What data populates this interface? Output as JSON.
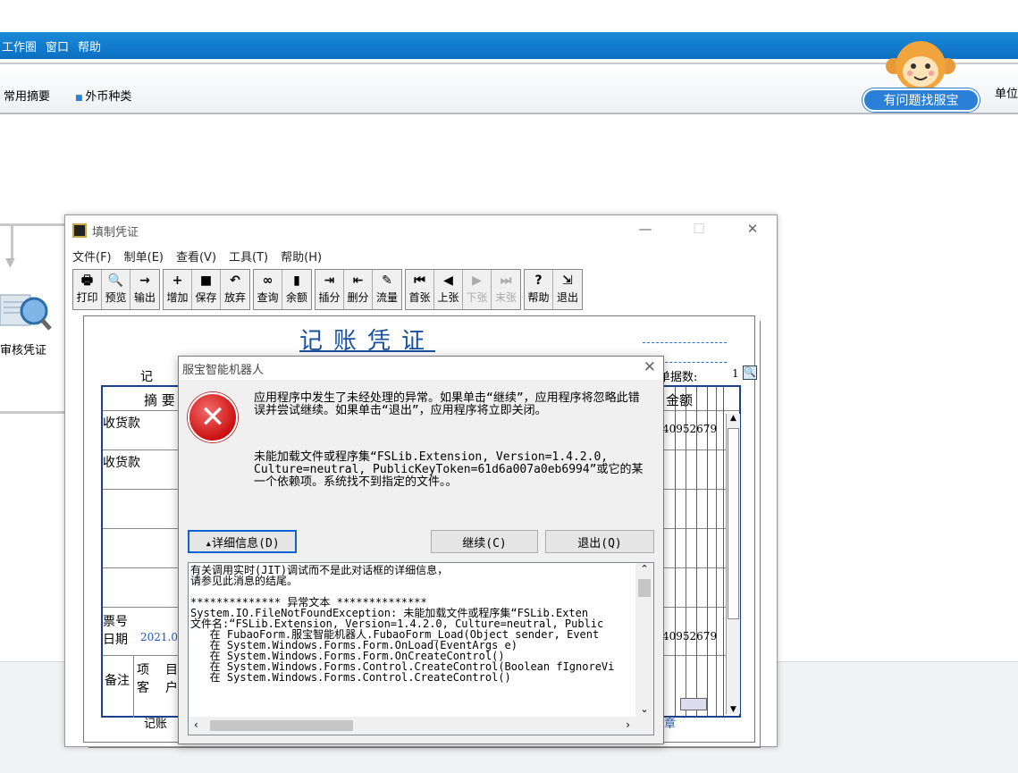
{
  "menubar": {
    "items": [
      "工作圈",
      "窗口",
      "帮助"
    ]
  },
  "quickbar": {
    "items": [
      "常用摘要",
      "外币种类"
    ],
    "right_cut": "单位"
  },
  "help_pill": "有问题找服宝",
  "flow": {
    "review_label": "审核凭证"
  },
  "voucher_window": {
    "title": "填制凭证",
    "menu": [
      "文件(F)",
      "制单(E)",
      "查看(V)",
      "工具(T)",
      "帮助(H)"
    ],
    "toolbar": [
      {
        "label": "打印",
        "icon": "printer-icon",
        "glyph": "🖶"
      },
      {
        "label": "预览",
        "icon": "preview-icon",
        "glyph": "🔍"
      },
      {
        "label": "输出",
        "icon": "export-icon",
        "glyph": "→"
      },
      {
        "label": "增加",
        "icon": "add-icon",
        "glyph": "+"
      },
      {
        "label": "保存",
        "icon": "save-icon",
        "glyph": "■"
      },
      {
        "label": "放弃",
        "icon": "undo-icon",
        "glyph": "↶"
      },
      {
        "label": "查询",
        "icon": "binoculars-icon",
        "glyph": "∞"
      },
      {
        "label": "余额",
        "icon": "bar-chart-icon",
        "glyph": "▮"
      },
      {
        "label": "插分",
        "icon": "insert-row-icon",
        "glyph": "⇥"
      },
      {
        "label": "删分",
        "icon": "delete-row-icon",
        "glyph": "⇤"
      },
      {
        "label": "流量",
        "icon": "flow-icon",
        "glyph": "✎"
      },
      {
        "label": "首张",
        "icon": "first-icon",
        "glyph": "⏮"
      },
      {
        "label": "上张",
        "icon": "prev-icon",
        "glyph": "◀"
      },
      {
        "label": "下张",
        "icon": "next-icon",
        "glyph": "▶",
        "disabled": true
      },
      {
        "label": "末张",
        "icon": "last-icon",
        "glyph": "⏭",
        "disabled": true
      },
      {
        "label": "帮助",
        "icon": "help-icon",
        "glyph": "?"
      },
      {
        "label": "退出",
        "icon": "exit-icon",
        "glyph": "⇲"
      }
    ],
    "heading": "记账凭证",
    "prefix": "记",
    "attach_label": "单据数:",
    "attach_count": "1",
    "col_summary": "摘 要",
    "col_amount": "金额",
    "rows": [
      {
        "summary": "收货款",
        "amount": "40952679"
      },
      {
        "summary": "收货款",
        "amount": ""
      }
    ],
    "ticket_label": "票号",
    "date_label": "日期",
    "date_value": "2021.0",
    "total_amount": "40952679",
    "remark_label": "备注",
    "remark_sub1": "项",
    "remark_sub2": "目",
    "remark_sub3": "客",
    "remark_sub4": "户",
    "bookkeeper_label": "记账",
    "stamp_cut": "章"
  },
  "dialog": {
    "title": "服宝智能机器人",
    "message1": "应用程序中发生了未经处理的异常。如果单击“继续”，应用程序将忽略此错误并尝试继续。如果单击“退出”，应用程序将立即关闭。",
    "message2": "未能加载文件或程序集“FSLib.Extension, Version=1.4.2.0, Culture=neutral, PublicKeyToken=61d6a007a0eb6994”或它的某一个依赖项。系统找不到指定的文件。。",
    "detail_button": "▴详细信息(D)",
    "continue_button": "继续(C)",
    "quit_button": "退出(Q)",
    "detail_text": "有关调用实时(JIT)调试而不是此对话框的详细信息，\n请参见此消息的结尾。\n\n************** 异常文本 **************\nSystem.IO.FileNotFoundException: 未能加载文件或程序集“FSLib.Exten\n文件名:“FSLib.Extension, Version=1.4.2.0, Culture=neutral, Public\n   在 FubaoForm.服宝智能机器人.FubaoForm_Load(Object sender, Event\n   在 System.Windows.Forms.Form.OnLoad(EventArgs e)\n   在 System.Windows.Forms.Form.OnCreateControl()\n   在 System.Windows.Forms.Control.CreateControl(Boolean fIgnoreVi\n   在 System.Windows.Forms.Control.CreateControl()"
  }
}
